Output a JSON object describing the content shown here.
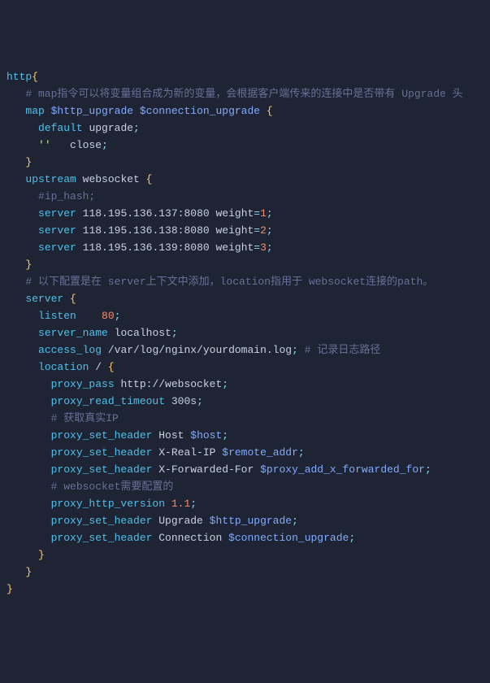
{
  "lines": {
    "l1": {
      "a": "http",
      "b": "{"
    },
    "l2": {
      "c": "# map指令可以将变量组合成为新的变量，会根据客户端传来的连接中是否带有 Upgrade 头"
    },
    "l3": {
      "k": "map",
      "v1": "$http_upgrade",
      "v2": "$connection_upgrade",
      "b": "{"
    },
    "l4": {
      "k": "default",
      "v": "upgrade",
      "s": ";"
    },
    "l5": {
      "q": "''",
      "v": "close",
      "s": ";"
    },
    "l6": {
      "b": "}"
    },
    "l7": {
      "k": "upstream",
      "n": "websocket",
      "b": "{"
    },
    "l8": {
      "c": "#ip_hash;"
    },
    "l9": {
      "k": "server",
      "h": "118.195.136.137:8080",
      "w": "weight",
      "eq": "=",
      "n": "1",
      "s": ";"
    },
    "l10": {
      "k": "server",
      "h": "118.195.136.138:8080",
      "w": "weight",
      "eq": "=",
      "n": "2",
      "s": ";"
    },
    "l11": {
      "k": "server",
      "h": "118.195.136.139:8080",
      "w": "weight",
      "eq": "=",
      "n": "3",
      "s": ";"
    },
    "l12": {
      "b": "}"
    },
    "l13": {
      "c": "# 以下配置是在 server上下文中添加，location指用于 websocket连接的path。"
    },
    "l14": {
      "k": "server",
      "b": "{"
    },
    "l15": {
      "k": "listen",
      "n": "80",
      "s": ";"
    },
    "l16": {
      "k": "server_name",
      "v": "localhost",
      "s": ";"
    },
    "l17": {
      "k": "access_log",
      "p": "/var/log/nginx/yourdomain.log",
      "s": ";",
      "c": "# 记录日志路径"
    },
    "l18": {
      "k": "location",
      "p": "/",
      "b": "{"
    },
    "l19": {
      "k": "proxy_pass",
      "u": "http://websocket",
      "s": ";"
    },
    "l20": {
      "k": "proxy_read_timeout",
      "v": "300s",
      "s": ";"
    },
    "l21": {
      "c": "# 获取真实IP"
    },
    "l22": {
      "k": "proxy_set_header",
      "h": "Host",
      "v": "$host",
      "s": ";"
    },
    "l23": {
      "k": "proxy_set_header",
      "h": "X-Real-IP",
      "v": "$remote_addr",
      "s": ";"
    },
    "l24": {
      "k": "proxy_set_header",
      "h": "X-Forwarded-For",
      "v": "$proxy_add_x_forwarded_for",
      "s": ";"
    },
    "l25": {
      "c": "# websocket需要配置的"
    },
    "l26": {
      "k": "proxy_http_version",
      "n": "1.1",
      "s": ";"
    },
    "l27": {
      "k": "proxy_set_header",
      "h": "Upgrade",
      "v": "$http_upgrade",
      "s": ";"
    },
    "l28": {
      "k": "proxy_set_header",
      "h": "Connection",
      "v": "$connection_upgrade",
      "s": ";"
    },
    "l29": {
      "b": "}"
    },
    "l30": {
      "b": "}"
    },
    "l31": {
      "b": "}"
    }
  }
}
